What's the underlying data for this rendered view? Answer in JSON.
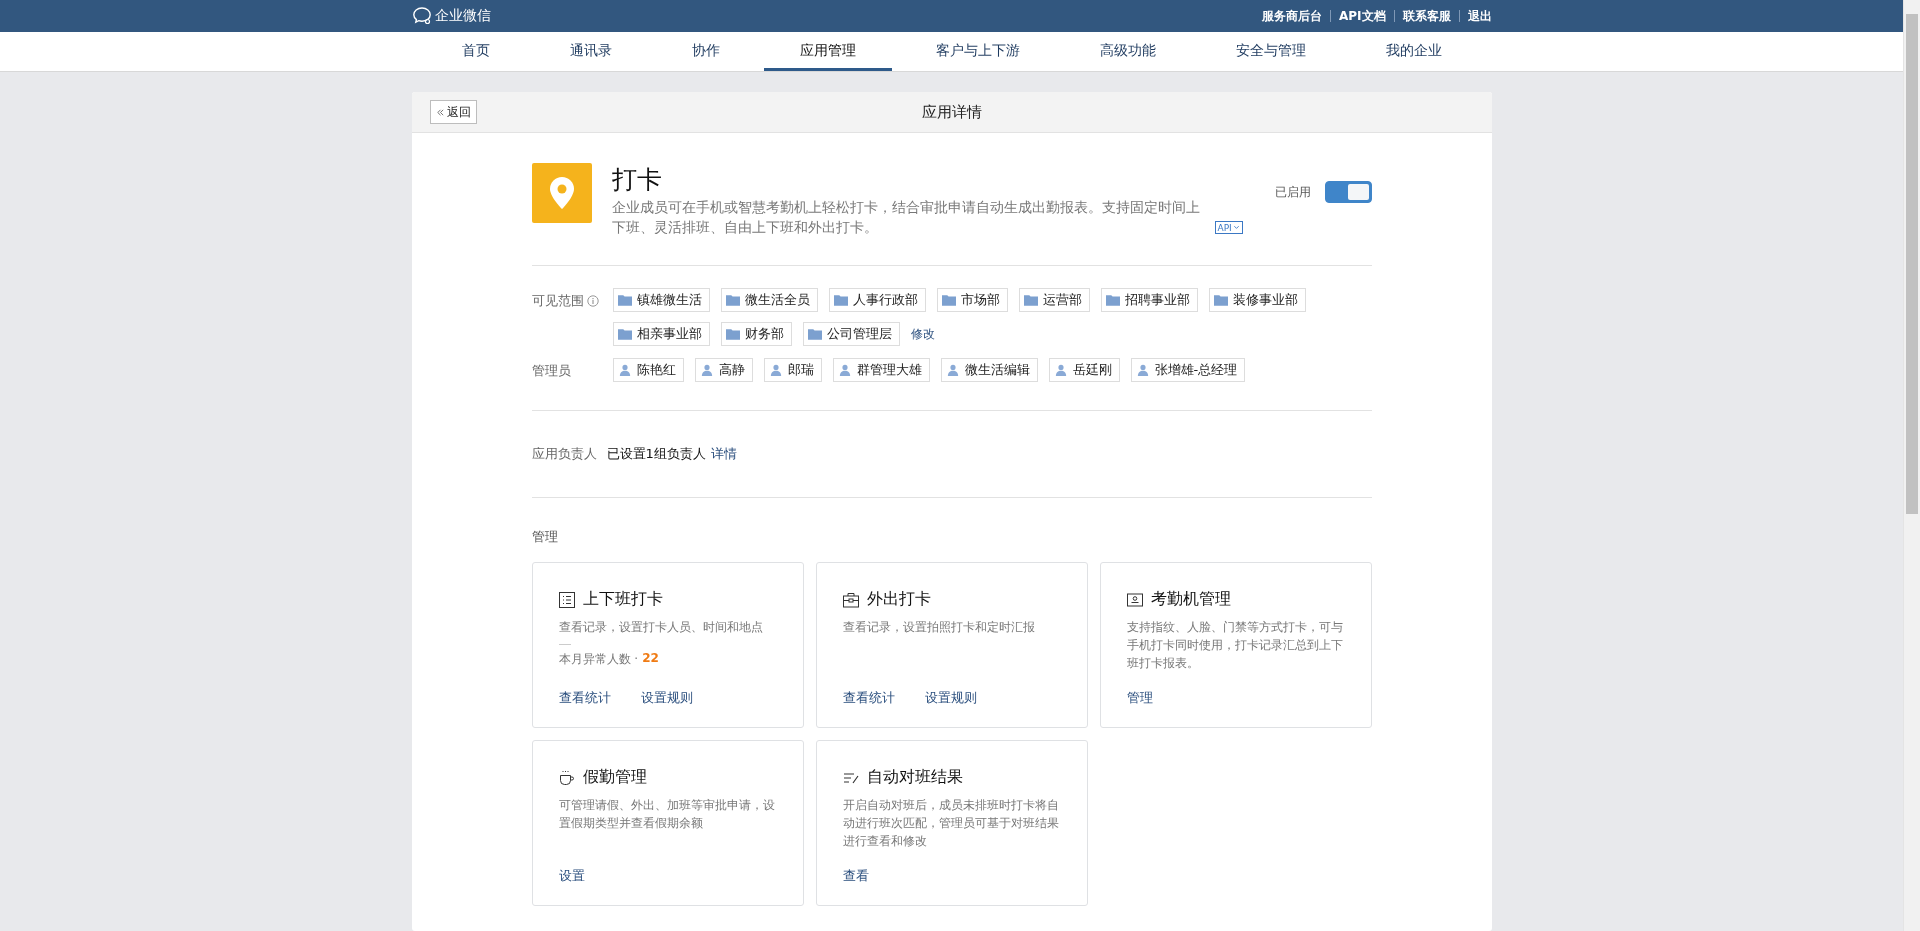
{
  "top_bar": {
    "logo_text": "企业微信",
    "links": [
      "服务商后台",
      "API文档",
      "联系客服",
      "退出"
    ]
  },
  "nav": [
    {
      "label": "首页",
      "selected": false
    },
    {
      "label": "通讯录",
      "selected": false
    },
    {
      "label": "协作",
      "selected": false
    },
    {
      "label": "应用管理",
      "selected": true
    },
    {
      "label": "客户与上下游",
      "selected": false
    },
    {
      "label": "高级功能",
      "selected": false
    },
    {
      "label": "安全与管理",
      "selected": false
    },
    {
      "label": "我的企业",
      "selected": false
    }
  ],
  "panel": {
    "back": "返回",
    "title": "应用详情"
  },
  "app": {
    "name": "打卡",
    "description": "企业成员可在手机或智慧考勤机上轻松打卡，结合审批申请自动生成出勤报表。支持固定时间上下班、灵活排班、自由上下班和外出打卡。",
    "api_tag": "API",
    "status_label": "已启用",
    "enabled": true
  },
  "visible_scope": {
    "label": "可见范围",
    "departments": [
      "镇雄微生活",
      "微生活全员",
      "人事行政部",
      "市场部",
      "运营部",
      "招聘事业部",
      "装修事业部",
      "相亲事业部",
      "财务部",
      "公司管理层"
    ],
    "edit_link": "修改"
  },
  "admins": {
    "label": "管理员",
    "people": [
      "陈艳红",
      "高静",
      "郎瑞",
      "群管理大雄",
      "微生活编辑",
      "岳廷刚",
      "张增雄-总经理"
    ]
  },
  "owner": {
    "label": "应用负责人",
    "value": "已设置1组负责人",
    "link": "详情"
  },
  "manage": {
    "heading": "管理",
    "cards": [
      {
        "title": "上下班打卡",
        "description": "查看记录，设置打卡人员、时间和地点",
        "stat_label": "本月异常人数 ·",
        "stat_value": "22",
        "actions": [
          "查看统计",
          "设置规则"
        ]
      },
      {
        "title": "外出打卡",
        "description": "查看记录，设置拍照打卡和定时汇报",
        "actions": [
          "查看统计",
          "设置规则"
        ]
      },
      {
        "title": "考勤机管理",
        "description": "支持指纹、人脸、门禁等方式打卡，可与手机打卡同时使用，打卡记录汇总到上下班打卡报表。",
        "actions": [
          "管理"
        ]
      },
      {
        "title": "假勤管理",
        "description": "可管理请假、外出、加班等审批申请，设置假期类型并查看假期余额",
        "actions": [
          "设置"
        ]
      },
      {
        "title": "自动对班结果",
        "description": "开启自动对班后，成员未排班时打卡将自动进行班次匹配，管理员可基于对班结果进行查看和修改",
        "actions": [
          "查看"
        ]
      }
    ]
  }
}
